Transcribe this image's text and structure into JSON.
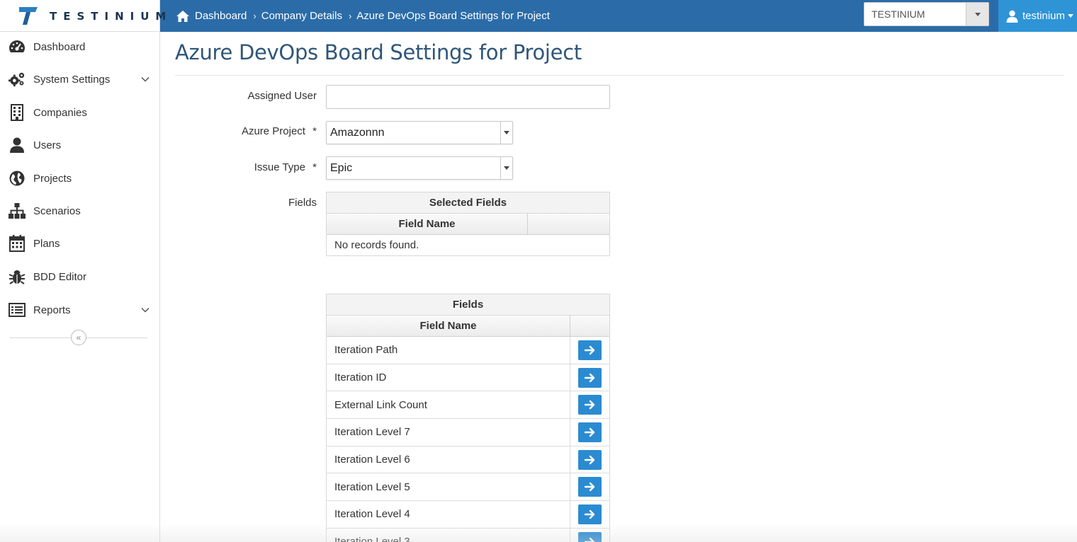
{
  "brand": {
    "name": "TESTINIUM",
    "logo_icon": "testinium-t-logo"
  },
  "breadcrumb": {
    "items": [
      {
        "label": "Dashboard",
        "icon": "home-icon"
      },
      {
        "label": "Company Details"
      },
      {
        "label": "Azure DevOps Board Settings for Project"
      }
    ]
  },
  "header": {
    "project_select_value": "TESTINIUM",
    "user_name": "testinium",
    "accent_color": "#2b6ca8",
    "user_bg_color": "#2e94d6"
  },
  "sidebar": {
    "items": [
      {
        "label": "Dashboard",
        "icon": "dashboard-gauge-icon"
      },
      {
        "label": "System Settings",
        "icon": "gears-icon",
        "expandable": true
      },
      {
        "label": "Companies",
        "icon": "building-icon"
      },
      {
        "label": "Users",
        "icon": "user-icon"
      },
      {
        "label": "Projects",
        "icon": "globe-icon"
      },
      {
        "label": "Scenarios",
        "icon": "sitemap-icon"
      },
      {
        "label": "Plans",
        "icon": "calendar-icon"
      },
      {
        "label": "BDD Editor",
        "icon": "bug-icon"
      },
      {
        "label": "Reports",
        "icon": "list-icon",
        "expandable": true
      }
    ],
    "collapse_label": "«"
  },
  "page": {
    "title": "Azure DevOps Board Settings for Project"
  },
  "form": {
    "assigned_user": {
      "label": "Assigned User",
      "value": ""
    },
    "azure_project": {
      "label": "Azure Project",
      "required_mark": "*",
      "value": "Amazonnn"
    },
    "issue_type": {
      "label": "Issue Type",
      "required_mark": "*",
      "value": "Epic"
    },
    "fields_label": "Fields"
  },
  "selected_fields_table": {
    "caption": "Selected Fields",
    "column": "Field Name",
    "empty_text": "No records found."
  },
  "fields_table": {
    "caption": "Fields",
    "column": "Field Name",
    "action_icon": "arrow-right-icon",
    "rows": [
      "Iteration Path",
      "Iteration ID",
      "External Link Count",
      "Iteration Level 7",
      "Iteration Level 6",
      "Iteration Level 5",
      "Iteration Level 4",
      "Iteration Level 3"
    ]
  }
}
